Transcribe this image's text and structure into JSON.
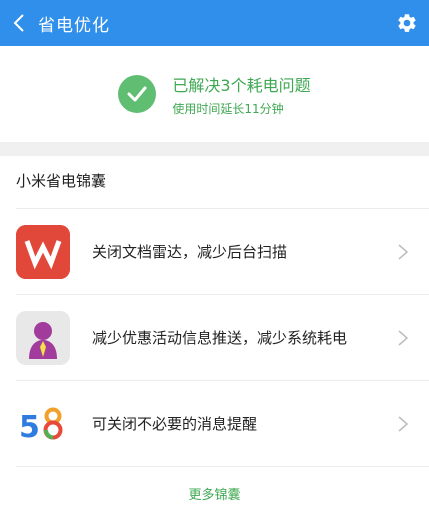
{
  "header": {
    "title": "省电优化",
    "back_icon": "chevron-left-icon",
    "settings_icon": "gear-icon",
    "color": "#2f8fea"
  },
  "status": {
    "icon": "check-circle-icon",
    "main_text": "已解决3个耗电问题",
    "sub_text": "使用时间延长11分钟",
    "color": "#3fa852"
  },
  "section": {
    "title": "小米省电锦囊"
  },
  "items": [
    {
      "app": "WPS",
      "icon": "wps-office-icon",
      "text": "关闭文档雷达，减少后台扫描"
    },
    {
      "app": "Agent",
      "icon": "agent-person-icon",
      "text": "减少优惠活动信息推送，减少系统耗电"
    },
    {
      "app": "58",
      "icon": "58-app-icon",
      "text": "可关闭不必要的消息提醒"
    }
  ],
  "more": {
    "label": "更多锦囊"
  }
}
